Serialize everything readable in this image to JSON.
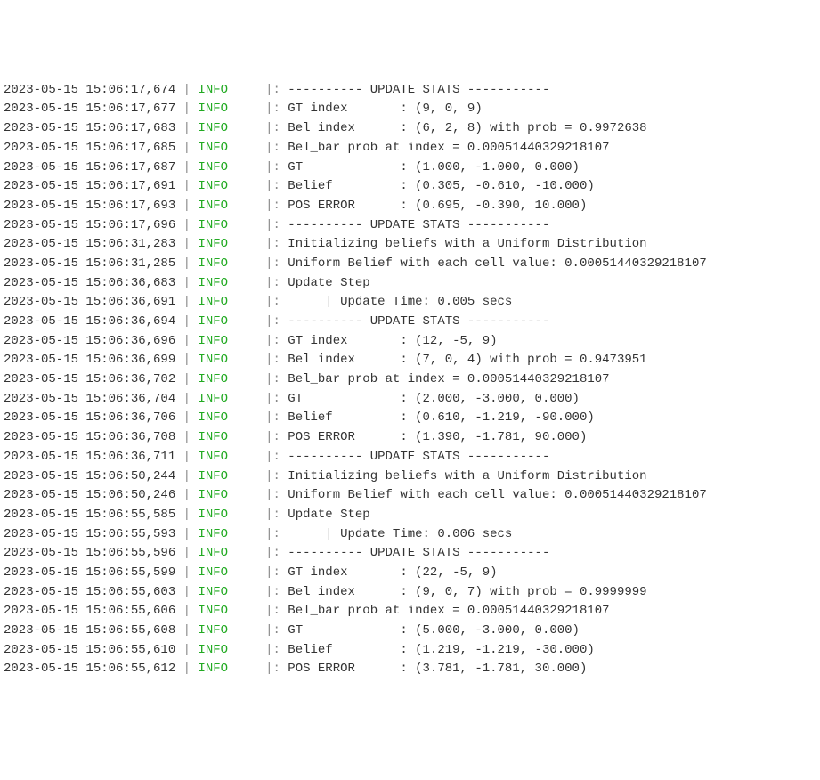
{
  "separator": " | ",
  "marker": "|: ",
  "lines": [
    {
      "ts": "2023-05-15 15:06:17,674",
      "level": "INFO",
      "msg": "---------- UPDATE STATS -----------"
    },
    {
      "ts": "2023-05-15 15:06:17,677",
      "level": "INFO",
      "msg": "GT index       : (9, 0, 9)"
    },
    {
      "ts": "2023-05-15 15:06:17,683",
      "level": "INFO",
      "msg": "Bel index      : (6, 2, 8) with prob = 0.9972638"
    },
    {
      "ts": "2023-05-15 15:06:17,685",
      "level": "INFO",
      "msg": "Bel_bar prob at index = 0.00051440329218107"
    },
    {
      "ts": "2023-05-15 15:06:17,687",
      "level": "INFO",
      "msg": "GT             : (1.000, -1.000, 0.000)"
    },
    {
      "ts": "2023-05-15 15:06:17,691",
      "level": "INFO",
      "msg": "Belief         : (0.305, -0.610, -10.000)"
    },
    {
      "ts": "2023-05-15 15:06:17,693",
      "level": "INFO",
      "msg": "POS ERROR      : (0.695, -0.390, 10.000)"
    },
    {
      "ts": "2023-05-15 15:06:17,696",
      "level": "INFO",
      "msg": "---------- UPDATE STATS -----------"
    },
    {
      "ts": "2023-05-15 15:06:31,283",
      "level": "INFO",
      "msg": "Initializing beliefs with a Uniform Distribution"
    },
    {
      "ts": "2023-05-15 15:06:31,285",
      "level": "INFO",
      "msg": "Uniform Belief with each cell value: 0.00051440329218107"
    },
    {
      "ts": "2023-05-15 15:06:36,683",
      "level": "INFO",
      "msg": "Update Step"
    },
    {
      "ts": "2023-05-15 15:06:36,691",
      "level": "INFO",
      "msg": "     | Update Time: 0.005 secs"
    },
    {
      "ts": "2023-05-15 15:06:36,694",
      "level": "INFO",
      "msg": "---------- UPDATE STATS -----------"
    },
    {
      "ts": "2023-05-15 15:06:36,696",
      "level": "INFO",
      "msg": "GT index       : (12, -5, 9)"
    },
    {
      "ts": "2023-05-15 15:06:36,699",
      "level": "INFO",
      "msg": "Bel index      : (7, 0, 4) with prob = 0.9473951"
    },
    {
      "ts": "2023-05-15 15:06:36,702",
      "level": "INFO",
      "msg": "Bel_bar prob at index = 0.00051440329218107"
    },
    {
      "ts": "2023-05-15 15:06:36,704",
      "level": "INFO",
      "msg": "GT             : (2.000, -3.000, 0.000)"
    },
    {
      "ts": "2023-05-15 15:06:36,706",
      "level": "INFO",
      "msg": "Belief         : (0.610, -1.219, -90.000)"
    },
    {
      "ts": "2023-05-15 15:06:36,708",
      "level": "INFO",
      "msg": "POS ERROR      : (1.390, -1.781, 90.000)"
    },
    {
      "ts": "2023-05-15 15:06:36,711",
      "level": "INFO",
      "msg": "---------- UPDATE STATS -----------"
    },
    {
      "ts": "2023-05-15 15:06:50,244",
      "level": "INFO",
      "msg": "Initializing beliefs with a Uniform Distribution"
    },
    {
      "ts": "2023-05-15 15:06:50,246",
      "level": "INFO",
      "msg": "Uniform Belief with each cell value: 0.00051440329218107"
    },
    {
      "ts": "2023-05-15 15:06:55,585",
      "level": "INFO",
      "msg": "Update Step"
    },
    {
      "ts": "2023-05-15 15:06:55,593",
      "level": "INFO",
      "msg": "     | Update Time: 0.006 secs"
    },
    {
      "ts": "2023-05-15 15:06:55,596",
      "level": "INFO",
      "msg": "---------- UPDATE STATS -----------"
    },
    {
      "ts": "2023-05-15 15:06:55,599",
      "level": "INFO",
      "msg": "GT index       : (22, -5, 9)"
    },
    {
      "ts": "2023-05-15 15:06:55,603",
      "level": "INFO",
      "msg": "Bel index      : (9, 0, 7) with prob = 0.9999999"
    },
    {
      "ts": "2023-05-15 15:06:55,606",
      "level": "INFO",
      "msg": "Bel_bar prob at index = 0.00051440329218107"
    },
    {
      "ts": "2023-05-15 15:06:55,608",
      "level": "INFO",
      "msg": "GT             : (5.000, -3.000, 0.000)"
    },
    {
      "ts": "2023-05-15 15:06:55,610",
      "level": "INFO",
      "msg": "Belief         : (1.219, -1.219, -30.000)"
    },
    {
      "ts": "2023-05-15 15:06:55,612",
      "level": "INFO",
      "msg": "POS ERROR      : (3.781, -1.781, 30.000)"
    }
  ]
}
